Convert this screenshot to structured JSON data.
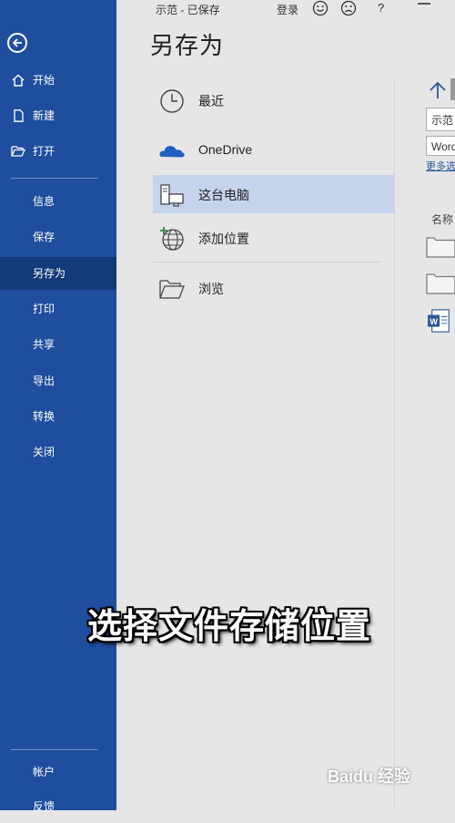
{
  "topbar": {
    "doc_title": "示范 - 已保存",
    "login": "登录",
    "help": "?"
  },
  "sidebar": {
    "items_top": [
      {
        "label": "开始",
        "icon": "home-icon"
      },
      {
        "label": "新建",
        "icon": "new-document-icon"
      },
      {
        "label": "打开",
        "icon": "open-folder-icon"
      }
    ],
    "items_mid": [
      {
        "label": "信息"
      },
      {
        "label": "保存"
      },
      {
        "label": "另存为",
        "active": true
      },
      {
        "label": "打印"
      },
      {
        "label": "共享"
      },
      {
        "label": "导出"
      },
      {
        "label": "转换"
      },
      {
        "label": "关闭"
      }
    ],
    "items_bottom": [
      {
        "label": "帐户"
      },
      {
        "label": "反馈"
      }
    ]
  },
  "main": {
    "heading": "另存为",
    "locations": [
      {
        "label": "最近",
        "icon": "clock-icon"
      },
      {
        "label": "OneDrive",
        "icon": "onedrive-cloud-icon"
      },
      {
        "label": "这台电脑",
        "icon": "this-pc-icon",
        "selected": true
      },
      {
        "label": "添加位置",
        "icon": "add-location-globe-icon"
      },
      {
        "label": "浏览",
        "icon": "browse-folder-icon"
      }
    ]
  },
  "file_pane": {
    "filename": "示范",
    "filetype": "Word",
    "more_options": "更多选",
    "column_name": "名称"
  },
  "overlay": {
    "caption": "选择文件存储位置",
    "watermark": "Baidu 经验"
  },
  "colors": {
    "sidebar": "#1f4e9e",
    "sidebar_active": "#123a78",
    "selected_location": "#c5d3ec",
    "background": "#e6e6e6"
  }
}
